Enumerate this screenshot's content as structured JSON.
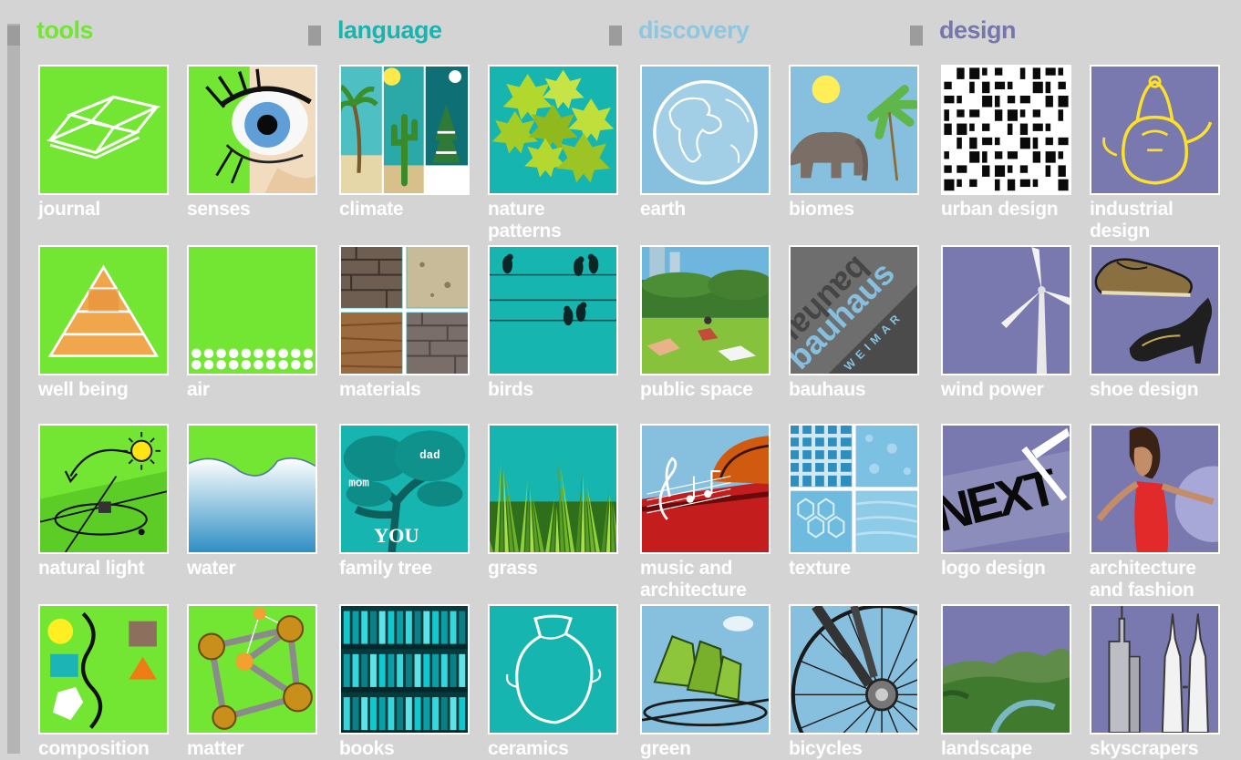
{
  "categories": [
    {
      "key": "tools",
      "label": "tools",
      "color": "#72e632",
      "tile_bg": "#72e632",
      "topics": [
        {
          "label": "journal",
          "icon": "open-book-icon"
        },
        {
          "label": "senses",
          "icon": "eye-icon"
        },
        {
          "label": "well being",
          "icon": "pyramid-icon"
        },
        {
          "label": "air",
          "icon": "air-dots-icon"
        },
        {
          "label": "natural light",
          "icon": "sun-path-icon"
        },
        {
          "label": "water",
          "icon": "water-wave-icon"
        },
        {
          "label": "composition",
          "icon": "shapes-icon"
        },
        {
          "label": "matter",
          "icon": "molecule-icon"
        }
      ]
    },
    {
      "key": "language",
      "label": "language",
      "color": "#16b5b0",
      "tile_bg": "#16b5b0",
      "topics": [
        {
          "label": "climate",
          "icon": "climate-icon"
        },
        {
          "label": "nature\npatterns",
          "icon": "leaves-icon"
        },
        {
          "label": "materials",
          "icon": "materials-icon"
        },
        {
          "label": "birds",
          "icon": "birds-on-wire-icon"
        },
        {
          "label": "family tree",
          "icon": "family-tree-icon",
          "words": [
            "dad",
            "mom",
            "YOU"
          ]
        },
        {
          "label": "grass",
          "icon": "grass-icon"
        },
        {
          "label": "books",
          "icon": "bookshelf-icon"
        },
        {
          "label": "ceramics",
          "icon": "vase-icon"
        }
      ]
    },
    {
      "key": "discovery",
      "label": "discovery",
      "color": "#8ec6df",
      "tile_bg": "#86c0de",
      "topics": [
        {
          "label": "earth",
          "icon": "globe-icon"
        },
        {
          "label": "biomes",
          "icon": "elephant-icon"
        },
        {
          "label": "public space",
          "icon": "park-icon"
        },
        {
          "label": "bauhaus",
          "icon": "bauhaus-icon",
          "words": [
            "bauhaus",
            "WEIMAR"
          ]
        },
        {
          "label": "music and\narchitecture",
          "icon": "music-icon"
        },
        {
          "label": "texture",
          "icon": "texture-icon"
        },
        {
          "label": "green",
          "icon": "green-building-icon"
        },
        {
          "label": "bicycles",
          "icon": "bicycle-wheel-icon"
        }
      ]
    },
    {
      "key": "design",
      "label": "design",
      "color": "#7676ac",
      "tile_bg": "#7979b0",
      "topics": [
        {
          "label": "urban design",
          "icon": "city-plan-icon"
        },
        {
          "label": "industrial\ndesign",
          "icon": "kettle-icon"
        },
        {
          "label": "wind power",
          "icon": "wind-turbine-icon"
        },
        {
          "label": "shoe design",
          "icon": "shoes-icon"
        },
        {
          "label": "logo design",
          "icon": "logo-icon",
          "words": [
            "NEXT"
          ]
        },
        {
          "label": "architecture\nand fashion",
          "icon": "fashion-icon"
        },
        {
          "label": "landscape",
          "icon": "landscape-icon"
        },
        {
          "label": "skyscrapers",
          "icon": "skyscraper-icon"
        }
      ]
    }
  ]
}
